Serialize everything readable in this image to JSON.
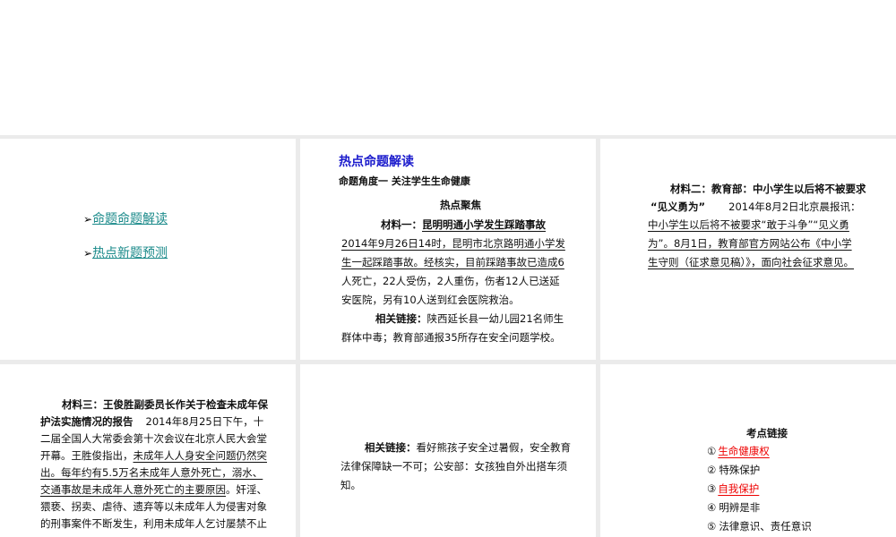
{
  "slides": [
    {
      "links": [
        "命题命题解读",
        "热点新题预测"
      ]
    },
    {
      "title": "热点命题解读",
      "subtitle": "命题角度一  关注学生生命健康",
      "section": "热点聚焦",
      "material_label": "材料一：",
      "material_title": "昆明明通小学发生踩踏事故",
      "lines": [
        "2014年9月26日14时，昆明市北京路明通小学发",
        "生一起踩踏事故。经核实，目前踩踏事故已造成6",
        "人死亡，22人受伤，2人重伤，伤者12人已送延",
        "安医院，另有10人送到红会医院救治。"
      ],
      "related_label": "相关链接：",
      "related_lines": [
        "陕西延长县一幼儿园21名师生",
        "群体中毒；教育部通报35所存在安全问题学校。"
      ]
    },
    {
      "heading_lines": [
        "材料二：教育部：中小学生以后将不被要求",
        "“见义勇为”"
      ],
      "dateline": "2014年8月2日北京晨报讯：",
      "lines": [
        "中小学生以后将不被要求“敢于斗争”“见义勇",
        "为”。8月1日，教育部官方网站公布《中小学",
        "生守则（征求意见稿）》，面向社会征求意见。"
      ]
    },
    {
      "heading_lines": [
        "材料三：王俊胜副委员长作关于检查未成年保",
        "护法实施情况的报告"
      ],
      "dateline": "2014年8月25日下午，十",
      "lines": [
        "二届全国人大常委会第十次会议在北京人民大会堂",
        "开幕。王胜俊指出，",
        "未成年人人身安全问题仍然突",
        "出。每年约有5.5万名未成年人意外死亡，溺水、",
        "交通事故是未成年人意外死亡的主要原因",
        "。奸淫、",
        "猥亵、拐卖、虐待、遗弃等以未成年人为侵害对象",
        "的刑事案件不断发生，利用未成年人乞讨屡禁不止"
      ]
    },
    {
      "related_label": "相关链接：",
      "related_lines": [
        "看好熊孩子安全过暑假，安全教育",
        "法律保障缺一不可；公安部：女孩独自外出搭车须",
        "知。"
      ]
    },
    {
      "title": "考点链接",
      "items": [
        {
          "num": "①",
          "text": "生命健康权",
          "answer": true
        },
        {
          "num": "②",
          "text": "特殊保护",
          "answer": false
        },
        {
          "num": "③",
          "text": "自我保护",
          "answer": true
        },
        {
          "num": "④",
          "text": "明辨是非",
          "answer": false
        },
        {
          "num": "⑤",
          "text": "法律意识、责任意识",
          "answer": false
        }
      ]
    }
  ]
}
